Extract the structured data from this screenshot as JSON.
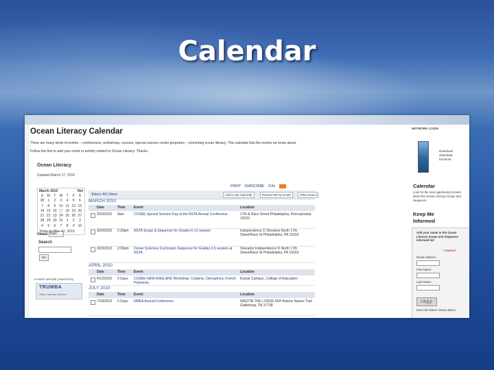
{
  "slide": {
    "title": "Calendar"
  },
  "page": {
    "title": "Ocean Literacy Calendar",
    "intro_line1": "There are many kinds of events -- conferences, workshops, courses, special science center programs -- promoting ocean literacy. This calendar lists the events we know about.",
    "intro_line2": "Follow this link to add your event or activity related to Ocean Literacy. Thanks."
  },
  "sidebar": {
    "calendar_name": "Ocean Literacy",
    "updated": "Updated March 17, 2010",
    "mini_calendar": {
      "month_label": "March 2010",
      "nav": "Nxt",
      "day_headers": [
        "S",
        "M",
        "T",
        "W",
        "T",
        "F",
        "S"
      ],
      "days": [
        "28",
        "1",
        "2",
        "3",
        "4",
        "5",
        "6",
        "7",
        "8",
        "9",
        "10",
        "11",
        "12",
        "13",
        "14",
        "15",
        "16",
        "17",
        "18",
        "19",
        "20",
        "21",
        "22",
        "23",
        "24",
        "25",
        "26",
        "27",
        "28",
        "29",
        "30",
        "31",
        "1",
        "2",
        "3",
        "4",
        "5",
        "6",
        "7",
        "8",
        "9",
        "10"
      ],
      "today_label": "Today is: Mar. 17, 2010"
    },
    "views_label": "Views",
    "views_value": "Table",
    "search_label": "Search",
    "go_label": "Go",
    "hosted_label": "Hosted calendar powered by",
    "trumba_logo": "TRUMBA",
    "trumba_tagline": "Online Calendar Services"
  },
  "toolbar": {
    "print": "PRINT",
    "subscribe": "SUBSCRIBE",
    "ical": "iCAL",
    "select_prefix": "Select:",
    "select_all": "All",
    "select_none": "None",
    "add_button": "Add to My Calendar",
    "remind_button": "Remind Me by Email",
    "other_actions": "Other Event Actions..."
  },
  "table": {
    "headers": {
      "date": "Date",
      "time": "Time",
      "event": "Event",
      "location": "Location"
    },
    "sections": [
      {
        "month": "MARCH 2010",
        "rows": [
          {
            "date": "3/20/2010",
            "time": "9am",
            "event": "COSEE Special Session Day at the NSTA Annual Conference",
            "location": "17th & Race Street Philadelphia, Pennsylvania 19103"
          },
          {
            "date": "3/20/2010",
            "time": "2:30pm",
            "event": "NSTA Scope & Sequence for Grades K-12 session",
            "location": "Independence D Sheraton North 17th Street/Race St Philadelphia, PA 19103"
          },
          {
            "date": "3/20/2010",
            "time": "2:30pm",
            "event": "Ocean Sciences Curriculum Sequence for Grades 3-5 session at NSTA",
            "location": "Sheraton Independence D North 17th Street/Race St Philadelphia, PA 19103"
          }
        ]
      },
      {
        "month": "APRIL 2010",
        "rows": [
          {
            "date": "4/12/2010",
            "time": "5 Days",
            "event": "COSEE-NEW ENGLAND Workshop: Cnidaria, Ctenophora, French Polynesia",
            "location": "Kumar Campus, College of Education"
          }
        ]
      },
      {
        "month": "JULY 2010",
        "rows": [
          {
            "date": "7/18/2010",
            "time": "5 Days",
            "event": "NMEA Annual Conference",
            "location": "WESTIN THE LODGE 604 Historic Nature Trail Gatlinburg, TN 37738"
          }
        ]
      }
    ]
  },
  "right_panel": {
    "login": "NETWORK LOGIN",
    "brochure_text": [
      "Download",
      "download",
      "brochure"
    ],
    "calendar_heading": "Calendar",
    "calendar_text": "Look for the next opportunity to learn about the Ocean Literacy Scope and Sequence",
    "keep_heading": "Keep Me Informed",
    "form_intro": "Add your name to the Ocean Literacy Scope and Sequence informed list",
    "required": "* required",
    "email_label": "Email Address:",
    "first_label": "First Name:",
    "last_label": "Last Name:",
    "captcha_text": "ragy",
    "captcha_hint": "Enter the letters shown above:"
  }
}
